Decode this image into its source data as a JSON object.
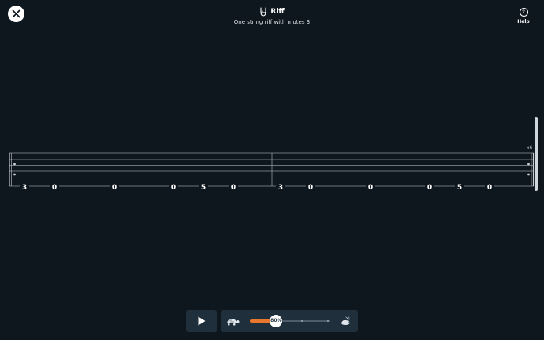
{
  "header": {
    "title": "Riff",
    "title_icon": "rock-hand-icon",
    "subtitle": "One string riff with mutes 3"
  },
  "help": {
    "label": "Help",
    "icon_glyph": "?"
  },
  "close": {
    "icon": "close-icon"
  },
  "tab": {
    "repeat_label": "x6",
    "measures": [
      {
        "notes": [
          "3",
          "0",
          "0",
          "0",
          "5",
          "0"
        ]
      },
      {
        "notes": [
          "3",
          "0",
          "0",
          "0",
          "5",
          "0"
        ]
      }
    ]
  },
  "player": {
    "play_icon": "play-icon",
    "speed": {
      "value_label": "80%",
      "level": 0.33,
      "slow_icon": "turtle-icon",
      "fast_icon": "rabbit-icon"
    }
  },
  "colors": {
    "background": "#0f171e",
    "panel": "#1f2f3c",
    "accent": "#e8772e"
  }
}
